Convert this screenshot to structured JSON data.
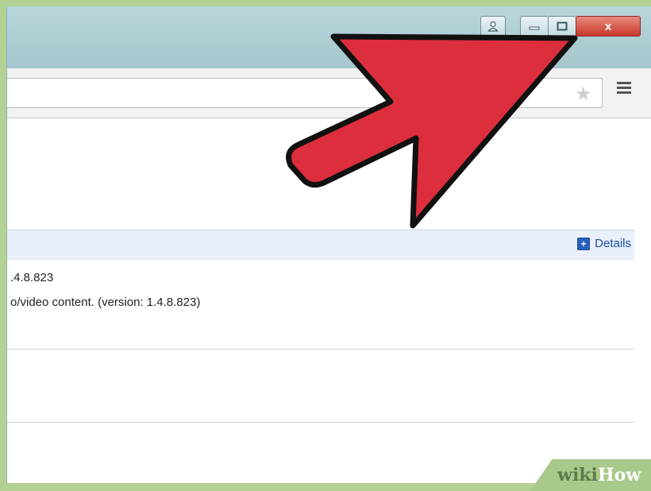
{
  "window": {
    "buttons": {
      "profile_icon": "person-icon",
      "minimize_icon": "minimize-icon",
      "maximize_icon": "maximize-icon",
      "close_label": "x"
    }
  },
  "toolbar": {
    "star_icon": "★",
    "menu_icon": "hamburger-menu-icon"
  },
  "plugin": {
    "details_label": "Details",
    "version_text": ".4.8.823",
    "description_text": "o/video content. (version: 1.4.8.823)"
  },
  "watermark": {
    "part1": "wiki",
    "part2": "How"
  },
  "colors": {
    "arrow_fill": "#dc2e3c",
    "arrow_stroke": "#111111",
    "close_button": "#c9392b",
    "link": "#1c4ea8"
  }
}
